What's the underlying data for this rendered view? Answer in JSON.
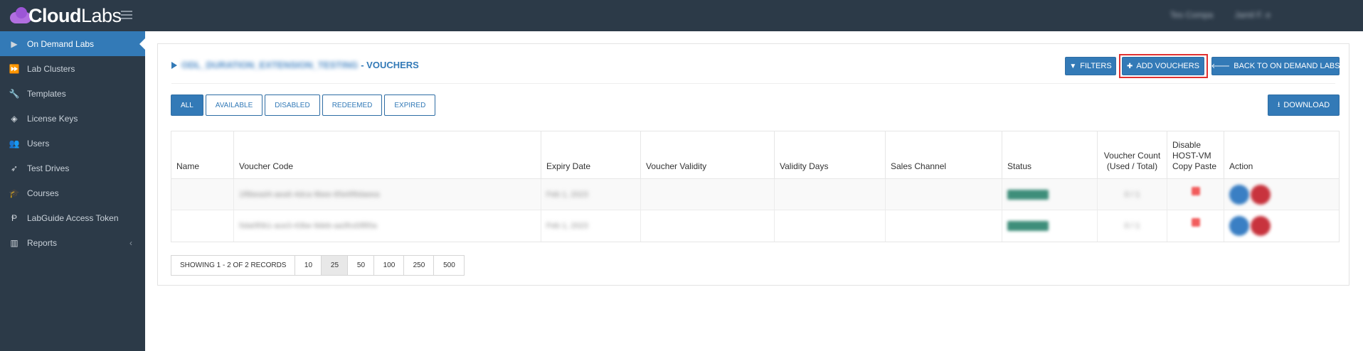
{
  "app": {
    "brand_bold": "Cloud",
    "brand_light": "Labs",
    "top_right": [
      "Tes Compa",
      "Jamil F. e"
    ]
  },
  "sidebar": {
    "items": [
      {
        "label": "On Demand Labs",
        "icon": "play-icon",
        "active": true
      },
      {
        "label": "Lab Clusters",
        "icon": "fast-forward-icon"
      },
      {
        "label": "Templates",
        "icon": "wrench-icon"
      },
      {
        "label": "License Keys",
        "icon": "tag-icon"
      },
      {
        "label": "Users",
        "icon": "users-icon"
      },
      {
        "label": "Test Drives",
        "icon": "rocket-icon"
      },
      {
        "label": "Courses",
        "icon": "graduation-cap-icon"
      },
      {
        "label": "LabGuide Access Token",
        "icon": "token-icon"
      },
      {
        "label": "Reports",
        "icon": "bar-chart-icon",
        "has_chevron": true
      }
    ]
  },
  "page": {
    "title_blurred": "ODL_DURATION_EXTENSION_TESTING",
    "title_suffix": "- VOUCHERS",
    "buttons": {
      "filters": "FILTERS",
      "add_vouchers": "ADD VOUCHERS",
      "back": "BACK TO ON DEMAND LABS",
      "download": "DOWNLOAD"
    },
    "tabs": [
      "ALL",
      "AVAILABLE",
      "DISABLED",
      "REDEEMED",
      "EXPIRED"
    ],
    "active_tab": "ALL"
  },
  "table": {
    "columns": [
      "Name",
      "Voucher Code",
      "Expiry Date",
      "Voucher Validity",
      "Validity Days",
      "Sales Channel",
      "Status",
      "Voucher Count (Used / Total)",
      "Disable HOST-VM Copy Paste",
      "Action"
    ],
    "rows": [
      {
        "name": "",
        "code": "1f8bead4-aea6-4dca-9bee-85e6f8daeea",
        "expiry": "Feb 1, 2023",
        "validity": "",
        "days": "",
        "channel": "",
        "status": "Available",
        "count": "0 / 1"
      },
      {
        "name": "",
        "code": "5da0f0b1-ace3-43be-9deb-aa3fcd3f85a",
        "expiry": "Feb 1, 2023",
        "validity": "",
        "days": "",
        "channel": "",
        "status": "Available",
        "count": "0 / 1"
      }
    ]
  },
  "pagination": {
    "info": "SHOWING 1 - 2 OF 2 RECORDS",
    "sizes": [
      "10",
      "25",
      "50",
      "100",
      "250",
      "500"
    ],
    "selected": "25"
  },
  "colors": {
    "primary": "#337ab7",
    "sidebar_bg": "#2c3a48",
    "highlight_frame": "#e03030"
  }
}
